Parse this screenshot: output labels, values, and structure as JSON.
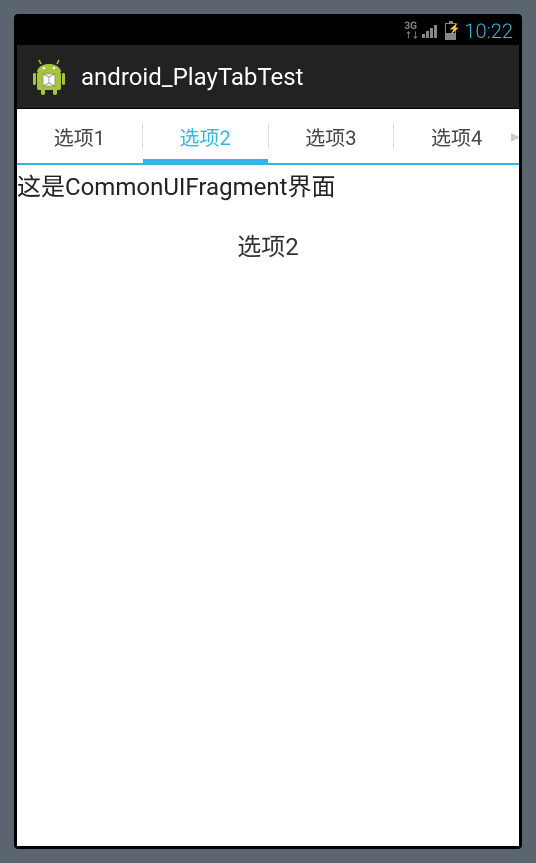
{
  "status": {
    "network_label": "3G",
    "time": "10:22"
  },
  "action_bar": {
    "title": "android_PlayTabTest"
  },
  "tabs": {
    "items": [
      {
        "label": "选项1",
        "selected": false
      },
      {
        "label": "选项2",
        "selected": true
      },
      {
        "label": "选项3",
        "selected": false
      },
      {
        "label": "选项4",
        "selected": false
      }
    ]
  },
  "content": {
    "fragment_text": "这是CommonUIFragment界面",
    "center_label": "选项2"
  }
}
